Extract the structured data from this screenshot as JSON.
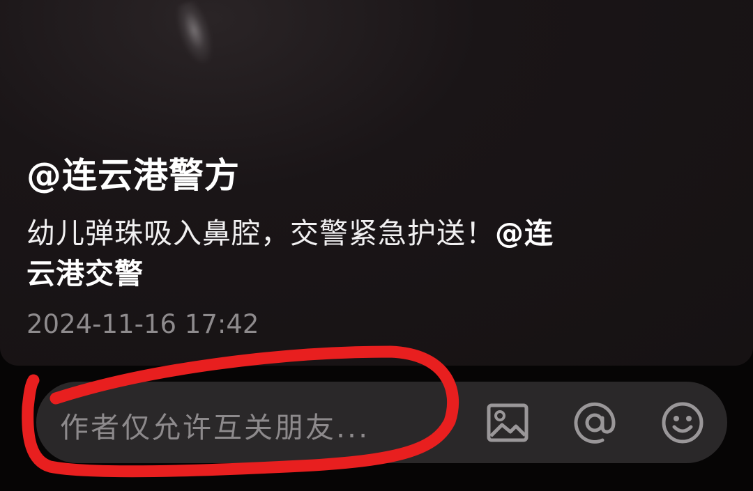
{
  "post": {
    "author": "@连云港警方",
    "caption_text": "幼儿弹珠吸入鼻腔，交警紧急护送！",
    "caption_mention": "@连云港交警",
    "timestamp": "2024-11-16 17:42"
  },
  "comment_bar": {
    "placeholder": "作者仅允许互关朋友...",
    "icons": [
      "image-icon",
      "at-icon",
      "emoji-icon"
    ]
  },
  "annotation": {
    "color": "#e81f1f"
  },
  "colors": {
    "background": "#060505",
    "card": "#161213",
    "comment_bar": "#2a2829",
    "text_primary": "#ffffff",
    "text_secondary": "#8e8b8d"
  }
}
